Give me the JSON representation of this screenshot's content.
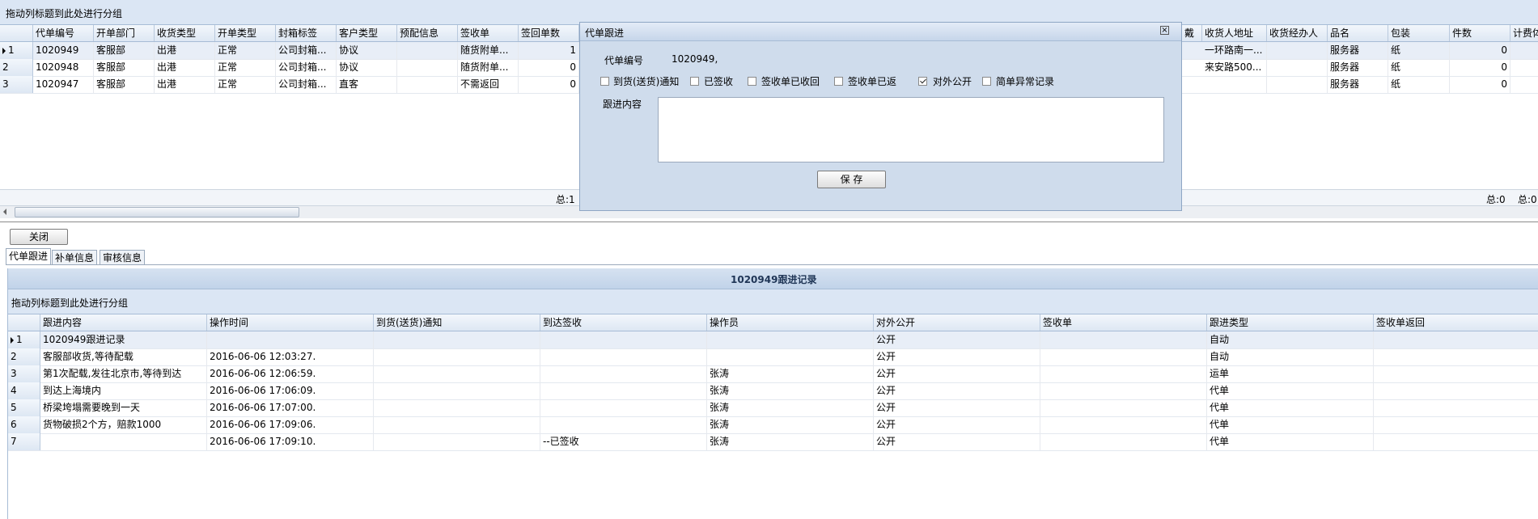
{
  "top_grid": {
    "group_hint": "拖动列标题到此处进行分组",
    "columns": [
      "代单编号",
      "开单部门",
      "收货类型",
      "开单类型",
      "封箱标签",
      "客户类型",
      "预配信息",
      "签收单",
      "签回单数"
    ],
    "right_columns": [
      "收货人地址",
      "收货经办人",
      "品名",
      "包装",
      "件数",
      "计费体"
    ],
    "rows": [
      {
        "num": "1",
        "cells": [
          "1020949",
          "客服部",
          "出港",
          "正常",
          "公司封箱...",
          "协议",
          "",
          "随货附单...",
          "1"
        ],
        "right": [
          "一环路南一...",
          "",
          "服务器",
          "纸",
          "0"
        ]
      },
      {
        "num": "2",
        "cells": [
          "1020948",
          "客服部",
          "出港",
          "正常",
          "公司封箱...",
          "协议",
          "",
          "随货附单...",
          "0"
        ],
        "right": [
          "来安路500...",
          "",
          "服务器",
          "纸",
          "0"
        ]
      },
      {
        "num": "3",
        "cells": [
          "1020947",
          "客服部",
          "出港",
          "正常",
          "公司封箱...",
          "直客",
          "",
          "不需返回",
          "0"
        ],
        "right": [
          "",
          "",
          "服务器",
          "纸",
          "0"
        ]
      }
    ],
    "partial_right_header": "戴",
    "footer_left": "总:1",
    "footer_right": "总:0",
    "footer_right2": "总:0"
  },
  "dialog": {
    "title": "代单跟进",
    "order_label": "代单编号",
    "order_value": "1020949,",
    "checkboxes": [
      {
        "label": "到货(送货)通知",
        "checked": false
      },
      {
        "label": "已签收",
        "checked": false
      },
      {
        "label": "签收单已收回",
        "checked": false
      },
      {
        "label": "签收单已返",
        "checked": false
      },
      {
        "label": "对外公开",
        "checked": true
      },
      {
        "label": "简单异常记录",
        "checked": false
      }
    ],
    "content_label": "跟进内容",
    "save_label": "保 存"
  },
  "close_button": "关闭",
  "tabs": [
    "代单跟进",
    "补单信息",
    "审核信息"
  ],
  "record_panel": {
    "title": "1020949跟进记录",
    "group_hint": "拖动列标题到此处进行分组",
    "columns": [
      "跟进内容",
      "操作时间",
      "到货(送货)通知",
      "到达签收",
      "操作员",
      "对外公开",
      "签收单",
      "跟进类型",
      "签收单返回"
    ],
    "rows": [
      {
        "num": "1",
        "cells": [
          "1020949跟进记录",
          "",
          "",
          "",
          "",
          "公开",
          "",
          "自动",
          ""
        ]
      },
      {
        "num": "2",
        "cells": [
          "客服部收货,等待配载",
          "2016-06-06 12:03:27.",
          "",
          "",
          "",
          "公开",
          "",
          "自动",
          ""
        ]
      },
      {
        "num": "3",
        "cells": [
          "第1次配载,发往北京市,等待到达",
          "2016-06-06 12:06:59.",
          "",
          "",
          "张涛",
          "公开",
          "",
          "运单",
          ""
        ]
      },
      {
        "num": "4",
        "cells": [
          "到达上海境内",
          "2016-06-06 17:06:09.",
          "",
          "",
          "张涛",
          "公开",
          "",
          "代单",
          ""
        ]
      },
      {
        "num": "5",
        "cells": [
          "桥梁垮塌需要晚到一天",
          "2016-06-06 17:07:00.",
          "",
          "",
          "张涛",
          "公开",
          "",
          "代单",
          ""
        ]
      },
      {
        "num": "6",
        "cells": [
          "货物破损2个方，赔款1000",
          "2016-06-06 17:09:06.",
          "",
          "",
          "张涛",
          "公开",
          "",
          "代单",
          ""
        ]
      },
      {
        "num": "7",
        "cells": [
          "",
          "2016-06-06 17:09:10.",
          "",
          "--已签收",
          "张涛",
          "公开",
          "",
          "代单",
          ""
        ]
      }
    ]
  },
  "colors": {
    "header_blue": "#dbe6f4",
    "dialog_bg": "#cfdcec",
    "border": "#a7bcd6"
  }
}
